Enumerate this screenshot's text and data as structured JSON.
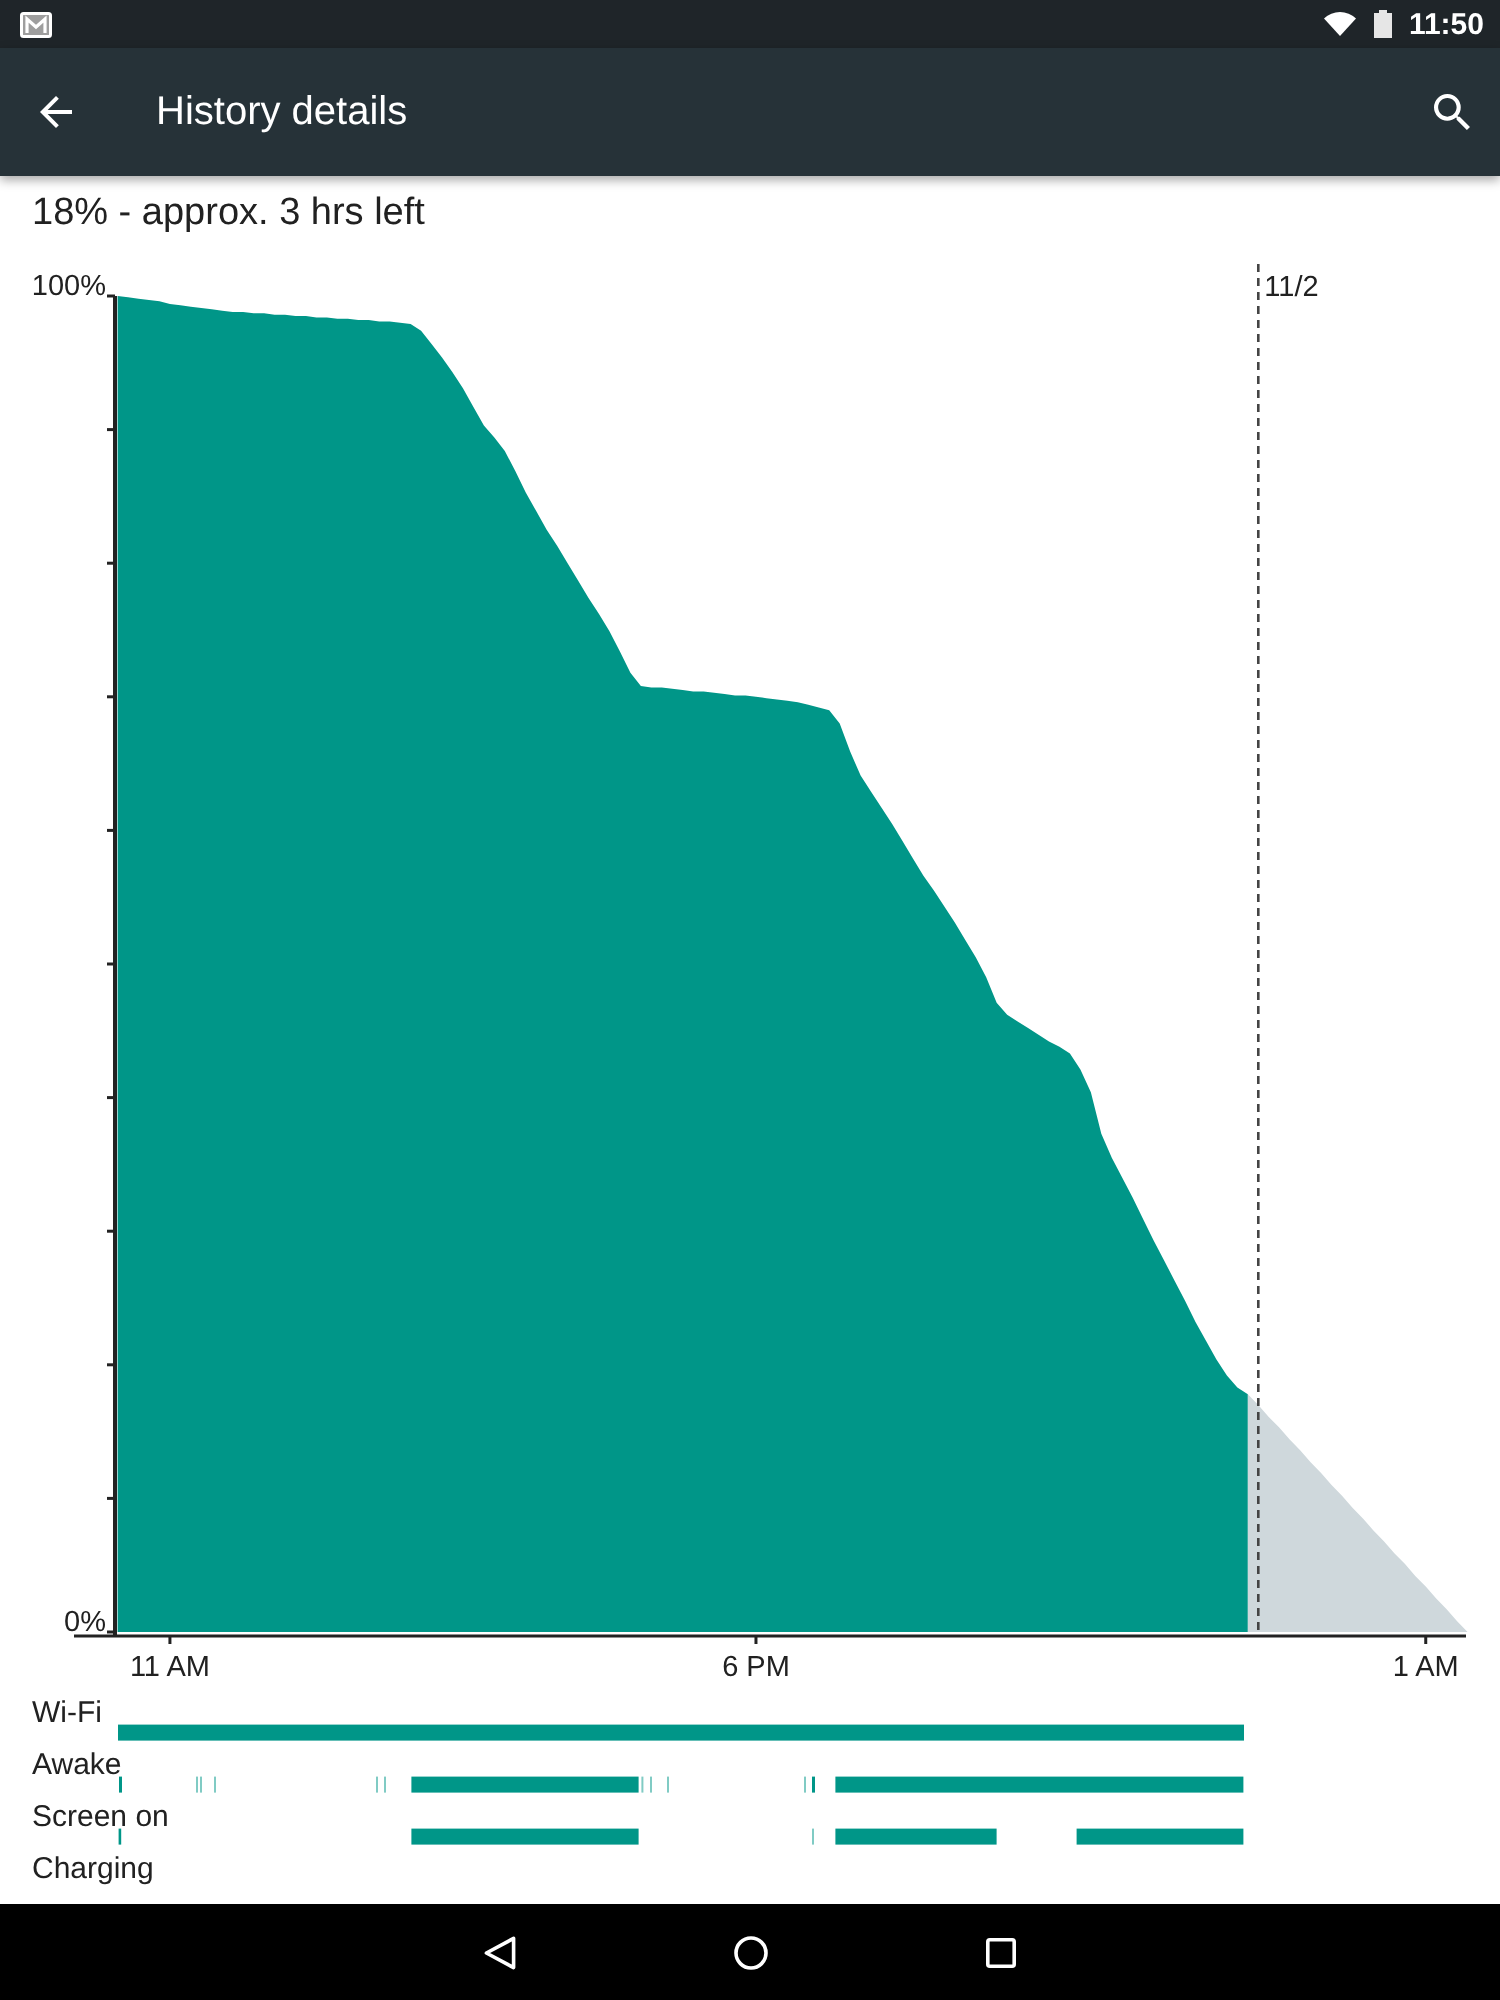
{
  "status_bar": {
    "time": "11:50"
  },
  "toolbar": {
    "title": "History details"
  },
  "summary": "18% - approx. 3 hrs left",
  "battery_chart": {
    "chart_data": {
      "type": "area",
      "categories": [
        null,
        null,
        null,
        null,
        null,
        "11 AM",
        null,
        null,
        null,
        null,
        null,
        null,
        null,
        null,
        null,
        null,
        null,
        null,
        null,
        null,
        null,
        null,
        null,
        null,
        null,
        null,
        null,
        null,
        null,
        null,
        null,
        null,
        null,
        null,
        null,
        null,
        null,
        null,
        null,
        null,
        null,
        null,
        null,
        null,
        null,
        null,
        null,
        null,
        null,
        null,
        null,
        null,
        null,
        null,
        null,
        null,
        null,
        null,
        null,
        null,
        null,
        "6 PM",
        null,
        null,
        null,
        null,
        null,
        null,
        null,
        null,
        null,
        null,
        null,
        null,
        null,
        null,
        null,
        null,
        null,
        null,
        null,
        null,
        null,
        null,
        null,
        null,
        null,
        null,
        null,
        null,
        null,
        null,
        null,
        null,
        null,
        null,
        null,
        null,
        null,
        null,
        null,
        null,
        null,
        null,
        null,
        null,
        null,
        null,
        null,
        null,
        null,
        null,
        null,
        null,
        null,
        null,
        null,
        null,
        null,
        null,
        null,
        null,
        null,
        null,
        null,
        "1 AM",
        null,
        null,
        null,
        null
      ],
      "series": [
        {
          "color": "#009688",
          "values": [
            100,
            99.9,
            99.8,
            99.7,
            99.6,
            99.4,
            99.3,
            99.2,
            99.1,
            99.0,
            98.9,
            98.8,
            98.8,
            98.7,
            98.7,
            98.6,
            98.6,
            98.5,
            98.5,
            98.4,
            98.4,
            98.3,
            98.3,
            98.2,
            98.2,
            98.1,
            98.1,
            98.0,
            97.9,
            97.4,
            96.4,
            95.4,
            94.3,
            93.1,
            91.7,
            90.3,
            89.4,
            88.4,
            86.9,
            85.3,
            83.9,
            82.5,
            81.3,
            80.0,
            78.7,
            77.4,
            76.2,
            74.9,
            73.4,
            71.8,
            70.8,
            70.7,
            70.7,
            70.6,
            70.5,
            70.4,
            70.4,
            70.3,
            70.2,
            70.1,
            70.1,
            70.0,
            69.9,
            69.8,
            69.7,
            69.6,
            69.4,
            69.2,
            69.0,
            68.0,
            65.9,
            64.1,
            62.9,
            61.7,
            60.5,
            59.2,
            57.9,
            56.6,
            55.5,
            54.3,
            53.1,
            51.8,
            50.5,
            49.0,
            47.1,
            46.2,
            45.7,
            45.2,
            44.7,
            44.2,
            43.8,
            43.3,
            42.1,
            40.4,
            37.3,
            35.5,
            34.0,
            32.5,
            30.9,
            29.3,
            27.8,
            26.3,
            24.8,
            23.2,
            21.8,
            20.4,
            19.2,
            18.3,
            17.8,
            null,
            null,
            null,
            null,
            null,
            null,
            null,
            null,
            null,
            null,
            null,
            null,
            null,
            null,
            null,
            null,
            null,
            null,
            null,
            null,
            null
          ]
        },
        {
          "color": "#cfd8dc",
          "values": [
            null,
            null,
            null,
            null,
            null,
            null,
            null,
            null,
            null,
            null,
            null,
            null,
            null,
            null,
            null,
            null,
            null,
            null,
            null,
            null,
            null,
            null,
            null,
            null,
            null,
            null,
            null,
            null,
            null,
            null,
            null,
            null,
            null,
            null,
            null,
            null,
            null,
            null,
            null,
            null,
            null,
            null,
            null,
            null,
            null,
            null,
            null,
            null,
            null,
            null,
            null,
            null,
            null,
            null,
            null,
            null,
            null,
            null,
            null,
            null,
            null,
            null,
            null,
            null,
            null,
            null,
            null,
            null,
            null,
            null,
            null,
            null,
            null,
            null,
            null,
            null,
            null,
            null,
            null,
            null,
            null,
            null,
            null,
            null,
            null,
            null,
            null,
            null,
            null,
            null,
            null,
            null,
            null,
            null,
            null,
            null,
            null,
            null,
            null,
            null,
            null,
            null,
            null,
            null,
            null,
            null,
            null,
            null,
            17.8,
            17.0,
            16.1,
            15.3,
            14.4,
            13.6,
            12.7,
            11.9,
            11.0,
            10.2,
            9.3,
            8.5,
            7.6,
            6.8,
            5.9,
            5.1,
            4.2,
            3.4,
            2.5,
            1.7,
            0.8,
            0
          ]
        }
      ],
      "ylim": [
        0,
        100
      ],
      "yticks": [
        {
          "value": 0,
          "label": "0%"
        },
        {
          "value": 100,
          "label": "100%"
        }
      ],
      "annotations": [
        "11/2"
      ]
    }
  },
  "timeline": [
    {
      "label": "Wi-Fi"
    },
    {
      "label": "Awake"
    },
    {
      "label": "Screen on"
    },
    {
      "label": "Charging"
    }
  ]
}
